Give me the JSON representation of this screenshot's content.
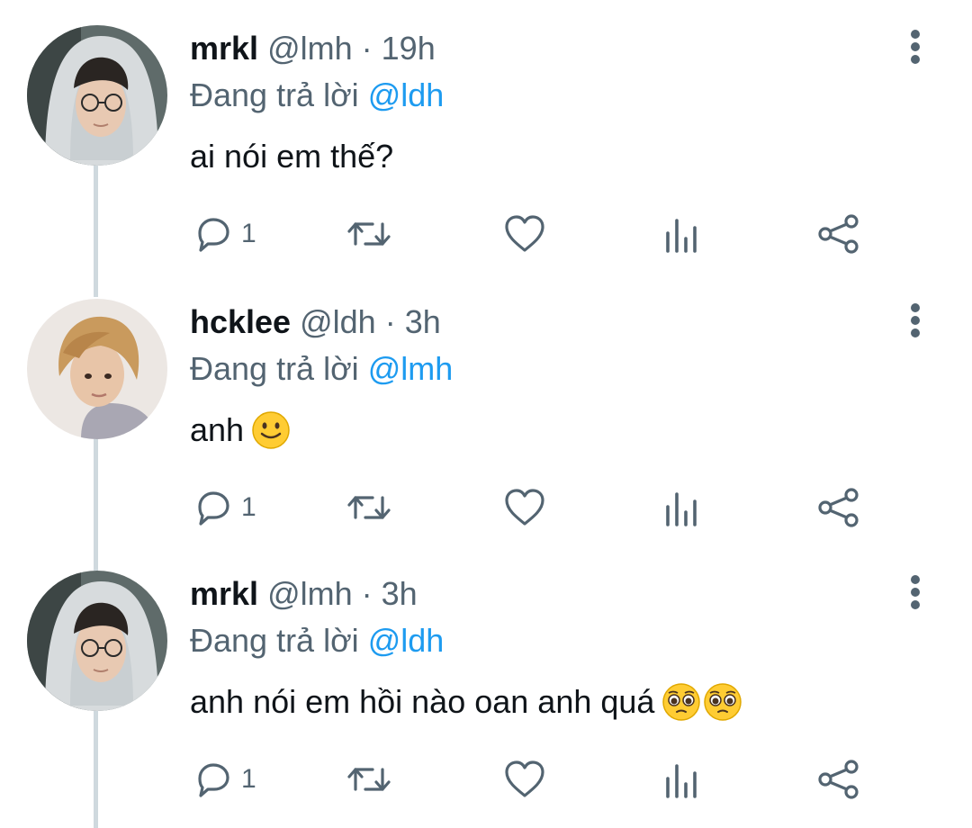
{
  "tweets": [
    {
      "name": "mrkl",
      "handle": "@lmh",
      "separator": "·",
      "time": "19h",
      "reply_prefix": "Đang trả lời",
      "reply_to": "@ldh",
      "text": "ai nói em thế?",
      "emojis": [],
      "reply_count": "1",
      "avatar": "avatar-hooded-glasses"
    },
    {
      "name": "hcklee",
      "handle": "@ldh",
      "separator": "·",
      "time": "3h",
      "reply_prefix": "Đang trả lời",
      "reply_to": "@lmh",
      "text": "anh",
      "emojis": [
        "slightly-smiling-face"
      ],
      "reply_count": "1",
      "avatar": "avatar-blond-hair"
    },
    {
      "name": "mrkl",
      "handle": "@lmh",
      "separator": "·",
      "time": "3h",
      "reply_prefix": "Đang trả lời",
      "reply_to": "@ldh",
      "text": "anh nói em hồi nào oan anh quá",
      "emojis": [
        "pleading-face",
        "pleading-face"
      ],
      "reply_count": "1",
      "avatar": "avatar-hooded-glasses"
    }
  ],
  "icons": {
    "reply": "reply-icon",
    "retweet": "retweet-icon",
    "like": "heart-icon",
    "analytics": "analytics-icon",
    "share": "share-icon",
    "more": "more-vertical-icon"
  },
  "colors": {
    "name": "#0f1419",
    "secondary": "#536471",
    "mention": "#1d9bf0",
    "thread_line": "#cfd9de"
  }
}
